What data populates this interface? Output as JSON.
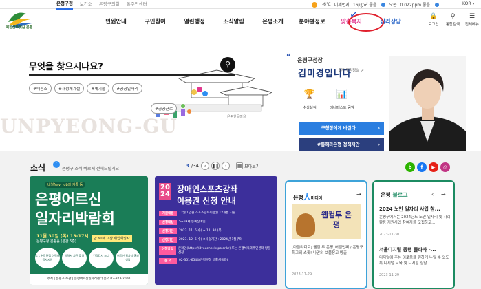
{
  "util_tabs": [
    "은평구청",
    "보건소",
    "은평구의회",
    "통주민센터"
  ],
  "weather": {
    "temp": "-6℃",
    "fine_dust_label": "미세먼지",
    "fine_dust_value": "16㎍/㎥ 좋음",
    "ozone_label": "오존",
    "ozone_value": "0.022ppm 좋음",
    "lang": "KOR"
  },
  "logo_text": "북한산뚜렛길 은평",
  "gnb": [
    "민원안내",
    "구민참여",
    "열린행정",
    "소식알림",
    "은평소개",
    "분야별정보",
    "맞춤복지",
    "심리상담"
  ],
  "header_icons": [
    {
      "label": "로그인",
      "icon": "lock-icon",
      "glyph": "🔒"
    },
    {
      "label": "통합검색",
      "icon": "search-icon",
      "glyph": "⚲"
    },
    {
      "label": "전체메뉴",
      "icon": "menu-icon",
      "glyph": "☰"
    }
  ],
  "search": {
    "title": "무엇을 찾으시나요?",
    "button_glyph": "⚲"
  },
  "tags": [
    "#패션쇼",
    "#재정체계절",
    "#폐기물",
    "#공공일자리"
  ],
  "tag_extra": "#공공근로",
  "watermark": "UNPYEONG-GU",
  "scene_label": "은평한옥마을",
  "mayor": {
    "title": "은평구청장",
    "name": "김미경입니다",
    "link": "열린구청장실",
    "icons": [
      {
        "label": "수상실적",
        "glyph": "🏆"
      },
      {
        "label": "매니페스토 공약",
        "glyph": "📊"
      }
    ],
    "btn1": "구청장에게 바란다",
    "btn2": "#통해라은평 정책제안",
    "arrow": "›"
  },
  "news": {
    "heading": "소식",
    "info": "은평구 소식 빠르게 전해드릴게요",
    "page_current": "3",
    "page_total": "/34",
    "more": "모아보기"
  },
  "poster1": {
    "top": "내일Navi Job과 가족 등",
    "title1": "은평어르신",
    "title2": "일자리박람회",
    "date": "11월 30일 (목) 13-17시",
    "place": "은평구청 은평홀 (본관 5층)",
    "badge": "만 60세 이상 취업희망자",
    "items": [
      "1:1 현장면접 이력서 증사지원",
      "이력서 사진 촬영",
      "건강검사 코너",
      "어르신 일자리 홍보 상담"
    ],
    "footer": "주최 | 은평구  주관 | 은평어르신일자리센터  문의 02-373-2000"
  },
  "poster2": {
    "year": "2024",
    "title1": "장애인스포츠강좌",
    "title2": "이용권 신청 안내",
    "rows": [
      {
        "k": "지원내용",
        "v": "12월 1인원 스포츠강좌이용권 12개월 지원"
      },
      {
        "k": "신청대상",
        "v": "5~69세 등록장애인"
      },
      {
        "k": "신청기간",
        "v": "2023. 11. 6(수) ~ 11. 30.(목)"
      },
      {
        "k": "신청기간",
        "v": "2023. 12. 6(수) ※사업기간 : 2024년 1월부터"
      },
      {
        "k": "신청방법",
        "v": "온라인(https://dvoucher.kspo.or.kr) 또는 은평체육과주민센터 방문 신청"
      },
      {
        "k": "문 의",
        "v": "02-351-6544(은평구청 생활체육과)"
      }
    ]
  },
  "card1": {
    "title_a": "은평",
    "title_b": "人",
    "title_c": "미디어",
    "thumb_text": "웹컴투 은평",
    "body": "[마을라디오] 웰컴 투 은평_어얼번쩨 / 은평구 최고의 스팟! 나만의 보물장고 방출",
    "date": "2023-11-29"
  },
  "card2": {
    "title_a": "은평",
    "title_b": "블로그",
    "item1": "2024 노인 일자리 사업 참...",
    "body1": "은평구에서는 2024년도 노인 일자리 및 사회활동 지원사업 참여자를 모집하고...",
    "date1": "2023-11-30",
    "item2": "서울디지털 동행 플라자 -...",
    "body2": "디지털이 주는 이로움을 편하게 누릴 수 있도록 디지털 교육 및 디지털 상담...",
    "date2": "2023-11-29"
  },
  "sns": [
    {
      "label": "b",
      "color": "#2db400"
    },
    {
      "label": "f",
      "color": "#1877f2"
    },
    {
      "label": "▶",
      "color": "#e62117"
    },
    {
      "label": "◎",
      "color": "#c13584"
    }
  ]
}
